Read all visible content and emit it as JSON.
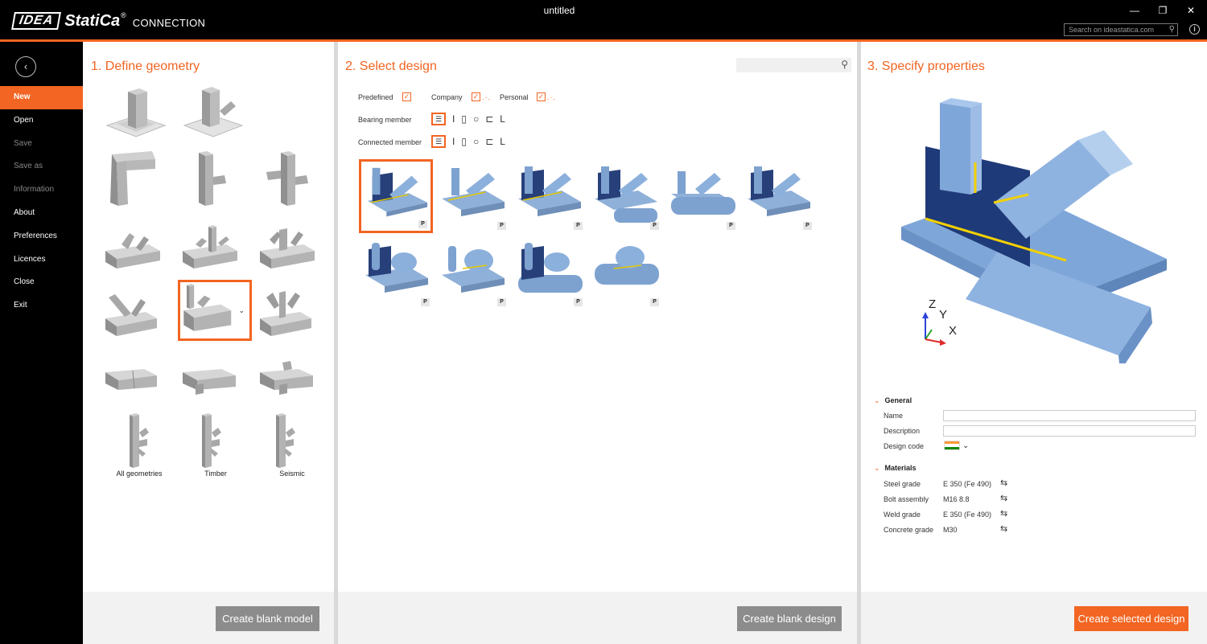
{
  "app": {
    "logo_idea": "IDEA",
    "logo_statica": "StatiCa",
    "logo_reg": "®",
    "product": "CONNECTION",
    "window_title": "untitled",
    "web_search_placeholder": "Search on ideastatica.com",
    "accent": "#f26522"
  },
  "sidebar": {
    "items": [
      {
        "label": "New",
        "state": "active"
      },
      {
        "label": "Open",
        "state": "enabled"
      },
      {
        "label": "Save",
        "state": "disabled"
      },
      {
        "label": "Save as",
        "state": "disabled"
      },
      {
        "label": "Information",
        "state": "disabled"
      },
      {
        "label": "About",
        "state": "enabled"
      },
      {
        "label": "Preferences",
        "state": "enabled"
      },
      {
        "label": "Licences",
        "state": "enabled"
      },
      {
        "label": "Close",
        "state": "enabled"
      },
      {
        "label": "Exit",
        "state": "enabled"
      }
    ]
  },
  "geometry": {
    "title": "1. Define geometry",
    "labels": {
      "all": "All geometries",
      "timber": "Timber",
      "seismic": "Seismic"
    },
    "create_blank_button": "Create blank model"
  },
  "design": {
    "title": "2. Select design",
    "filters": {
      "predefined": "Predefined",
      "company": "Company",
      "personal": "Personal",
      "bearing_member": "Bearing member",
      "connected_member": "Connected member"
    },
    "badge": "P",
    "create_blank_button": "Create blank design"
  },
  "properties": {
    "title": "3. Specify properties",
    "axes": {
      "z": "Z",
      "y": "Y",
      "x": "X"
    },
    "general": {
      "heading": "General",
      "name_label": "Name",
      "description_label": "Description",
      "design_code_label": "Design code"
    },
    "materials": {
      "heading": "Materials",
      "steel_label": "Steel grade",
      "steel_value": "E 350 (Fe 490)",
      "bolt_label": "Bolt assembly",
      "bolt_value": "M16 8.8",
      "weld_label": "Weld grade",
      "weld_value": "E 350 (Fe 490)",
      "concrete_label": "Concrete grade",
      "concrete_value": "M30"
    },
    "create_selected_button": "Create selected design"
  }
}
